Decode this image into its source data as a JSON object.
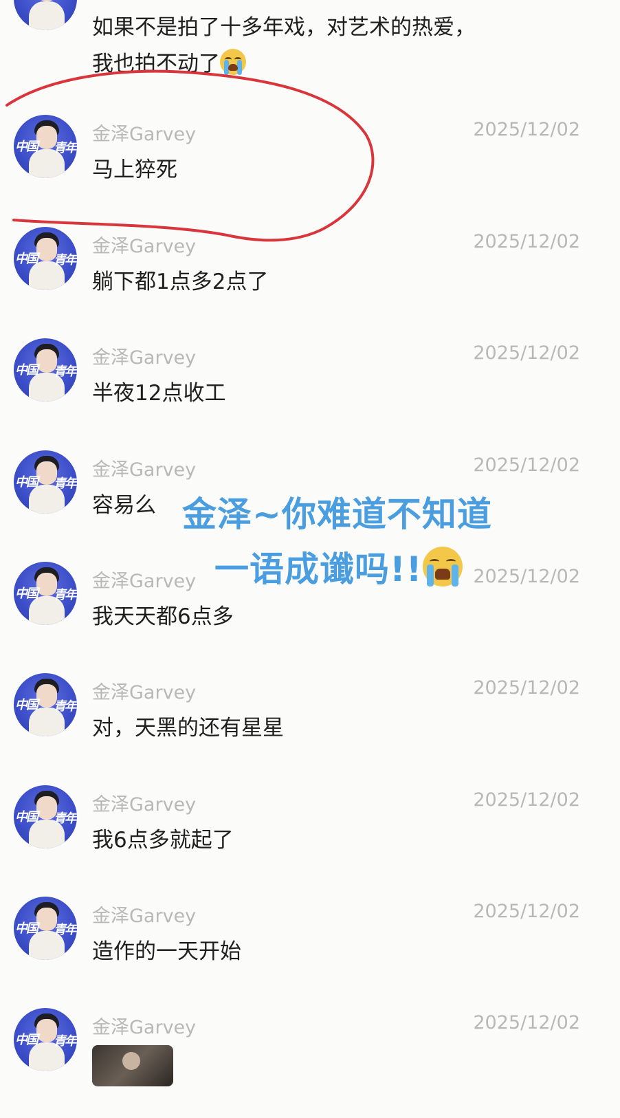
{
  "top_message": {
    "line1": "如果不是拍了十多年戏，对艺术的热爱，",
    "line2": "我也拍不动了",
    "emoji_icon": "loudly-crying-face-icon"
  },
  "avatar": {
    "text_left": "中国",
    "text_right": "青年"
  },
  "messages": [
    {
      "name": "金泽Garvey",
      "time": "2025/12/02",
      "text": "马上猝死"
    },
    {
      "name": "金泽Garvey",
      "time": "2025/12/02",
      "text": "躺下都1点多2点了"
    },
    {
      "name": "金泽Garvey",
      "time": "2025/12/02",
      "text": "半夜12点收工"
    },
    {
      "name": "金泽Garvey",
      "time": "2025/12/02",
      "text": "容易么"
    },
    {
      "name": "金泽Garvey",
      "time": "2025/12/02",
      "text": "我天天都6点多"
    },
    {
      "name": "金泽Garvey",
      "time": "2025/12/02",
      "text": "对，天黑的还有星星"
    },
    {
      "name": "金泽Garvey",
      "time": "2025/12/02",
      "text": "我6点多就起了"
    },
    {
      "name": "金泽Garvey",
      "time": "2025/12/02",
      "text": "造作的一天开始"
    },
    {
      "name": "金泽Garvey",
      "time": "2025/12/02",
      "text": ""
    }
  ],
  "overlay": {
    "line1": "金泽~你难道不知道",
    "line2": "一语成谶吗!!",
    "emoji_icon": "loudly-crying-face-icon",
    "color": "#4a9ee0"
  },
  "annotation": {
    "shape": "hand-drawn-circle",
    "color": "#d8363c"
  }
}
